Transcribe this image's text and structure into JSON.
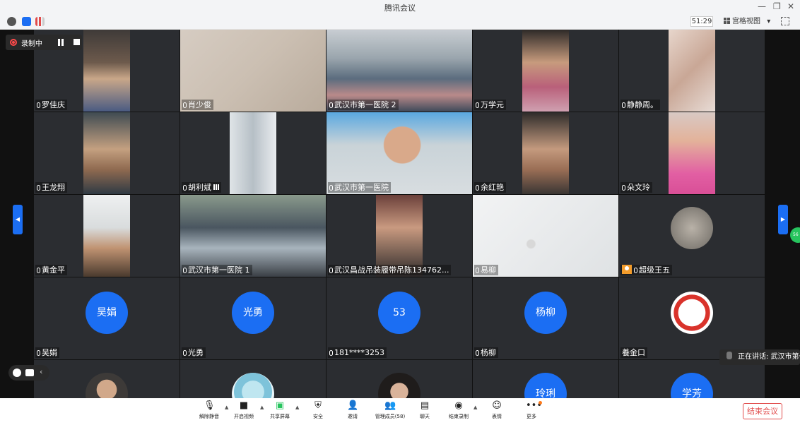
{
  "window": {
    "title": "腾讯会议"
  },
  "infobar": {
    "timer": "51:29",
    "view_mode": "宫格视图",
    "view_caret": "▾"
  },
  "recording": {
    "status": "录制中"
  },
  "tiles": [
    {
      "name": "罗佳庆"
    },
    {
      "name": "肖少俊"
    },
    {
      "name": "武汉市第一医院 2"
    },
    {
      "name": "万学元"
    },
    {
      "name": "静静周。"
    },
    {
      "name": "王龙翔"
    },
    {
      "name": "胡利斌"
    },
    {
      "name": "武汉市第一医院"
    },
    {
      "name": "余红艳"
    },
    {
      "name": "朵文玲"
    },
    {
      "name": "黄金平"
    },
    {
      "name": "武汉市第一医院 1"
    },
    {
      "name": "武汉昌战吊装履带吊陈134762..."
    },
    {
      "name": "易柳"
    },
    {
      "name": "超级王五"
    },
    {
      "name": "吴娟",
      "avatar_text": "吴娟"
    },
    {
      "name": "光勇",
      "avatar_text": "光勇"
    },
    {
      "name": "181****3253",
      "avatar_text": "53"
    },
    {
      "name": "杨柳",
      "avatar_text": "杨柳"
    },
    {
      "name": "養金口"
    },
    {
      "name": ""
    },
    {
      "name": ""
    },
    {
      "name": ""
    },
    {
      "name": "",
      "avatar_text": "玲琍"
    },
    {
      "name": "",
      "avatar_text": "学芳"
    }
  ],
  "speaking": {
    "label": "正在讲话: 武汉市第一"
  },
  "toolbar": {
    "items": [
      {
        "label": "解除静音",
        "icon": "mic-muted-icon"
      },
      {
        "label": "开启视频",
        "icon": "camera-off-icon"
      },
      {
        "label": "共享屏幕",
        "icon": "screen-share-icon"
      },
      {
        "label": "安全",
        "icon": "shield-icon"
      },
      {
        "label": "邀请",
        "icon": "invite-icon"
      },
      {
        "label": "管理成员(58)",
        "icon": "members-icon"
      },
      {
        "label": "聊天",
        "icon": "chat-icon"
      },
      {
        "label": "结束录制",
        "icon": "stop-record-icon"
      },
      {
        "label": "表情",
        "icon": "emoji-icon"
      },
      {
        "label": "更多",
        "icon": "more-icon"
      }
    ],
    "end_meeting": "结束会议"
  },
  "colors": {
    "accent": "#1b6ef3",
    "active_speaker": "#27c45e",
    "end_button": "#e14b4b",
    "recording": "#ff4a4a"
  }
}
